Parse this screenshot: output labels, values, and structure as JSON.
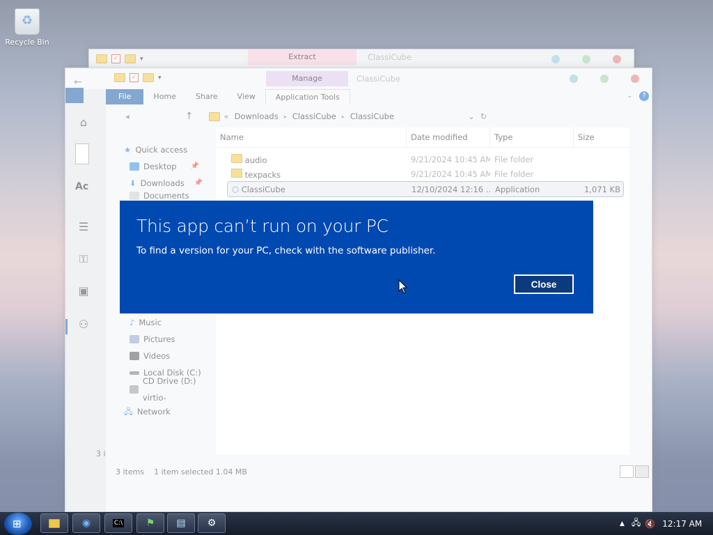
{
  "desktop": {
    "icon_label": "Recycle Bin"
  },
  "back_window": {
    "context_tab": "Extract",
    "title": "ClassiCube"
  },
  "main_window": {
    "context_tab": "Manage",
    "title": "ClassiCube",
    "ribbon_tabs": [
      "File",
      "Home",
      "Share",
      "View",
      "Application Tools"
    ],
    "address": {
      "crumbs": [
        "Downloads",
        "ClassiCube",
        "ClassiCube"
      ]
    },
    "nav": {
      "items": [
        {
          "label": "Quick access"
        },
        {
          "label": "Desktop"
        },
        {
          "label": "Downloads"
        },
        {
          "label": "Documents"
        },
        {
          "label": "Music"
        },
        {
          "label": "Pictures"
        },
        {
          "label": "Videos"
        },
        {
          "label": "Local Disk (C:)"
        },
        {
          "label": "CD Drive (D:) virtio-"
        },
        {
          "label": "Network"
        }
      ]
    },
    "columns": [
      "Name",
      "Date modified",
      "Type",
      "Size"
    ],
    "rows": [
      {
        "name": "audio",
        "date": "9/21/2024 10:45 AM",
        "type": "File folder",
        "size": ""
      },
      {
        "name": "texpacks",
        "date": "9/21/2024 10:45 AM",
        "type": "File folder",
        "size": ""
      },
      {
        "name": "ClassiCube",
        "date": "12/10/2024 12:16 ...",
        "type": "Application",
        "size": "1,071 KB"
      }
    ],
    "status": {
      "count": "3 items",
      "selected": "1 item selected  1.04 MB"
    },
    "left_rail_text": {
      "a": "Ac",
      "b": "3 i"
    }
  },
  "dialog": {
    "title": "This app can’t run on your PC",
    "message": "To find a version for your PC, check with the software publisher.",
    "close_label": "Close"
  },
  "taskbar": {
    "clock": "12:17 AM"
  }
}
